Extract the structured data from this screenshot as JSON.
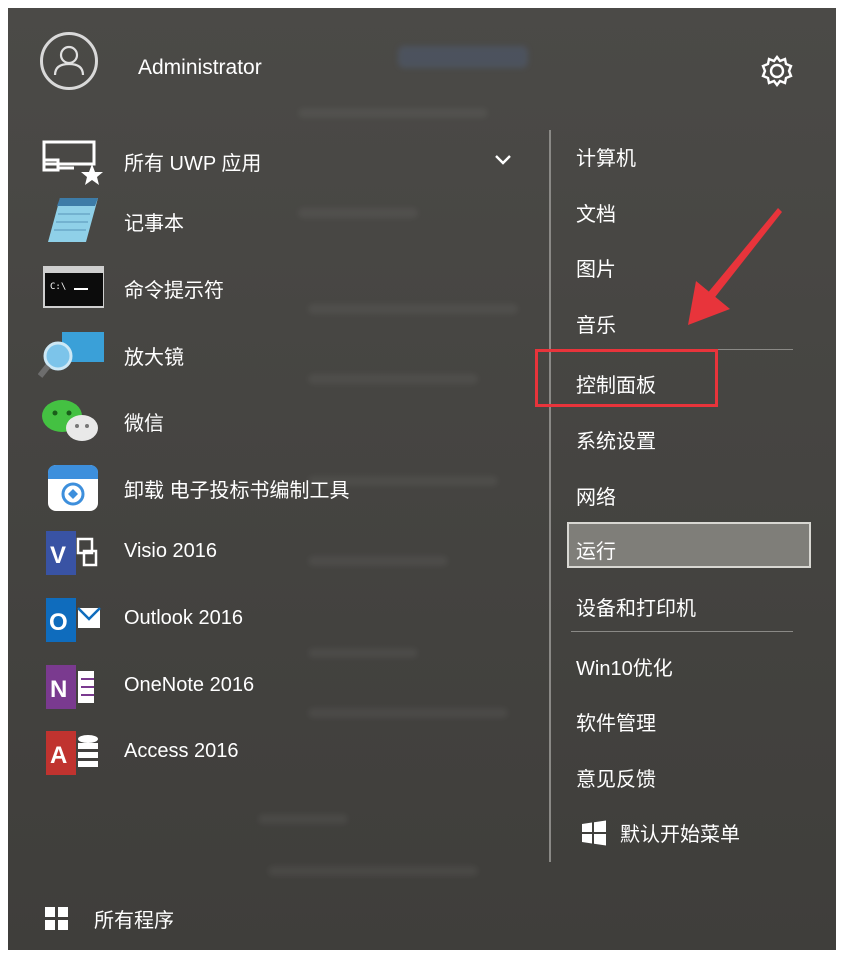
{
  "user": {
    "name": "Administrator"
  },
  "apps": [
    {
      "label": "所有 UWP 应用",
      "icon": "uwp-apps-icon"
    },
    {
      "label": "记事本",
      "icon": "notepad-icon"
    },
    {
      "label": "命令提示符",
      "icon": "cmd-icon"
    },
    {
      "label": "放大镜",
      "icon": "magnifier-icon"
    },
    {
      "label": "微信",
      "icon": "wechat-icon"
    },
    {
      "label": "卸载 电子投标书编制工具",
      "icon": "uninstall-icon"
    },
    {
      "label": "Visio 2016",
      "icon": "visio-icon"
    },
    {
      "label": "Outlook 2016",
      "icon": "outlook-icon"
    },
    {
      "label": "OneNote 2016",
      "icon": "onenote-icon"
    },
    {
      "label": "Access 2016",
      "icon": "access-icon"
    }
  ],
  "right": {
    "computer": "计算机",
    "documents": "文档",
    "pictures": "图片",
    "music": "音乐",
    "control_panel": "控制面板",
    "settings": "系统设置",
    "network": "网络",
    "run": "运行",
    "devices": "设备和打印机",
    "win10_optimize": "Win10优化",
    "software": "软件管理",
    "feedback": "意见反馈",
    "default_menu": "默认开始菜单"
  },
  "footer": {
    "all_programs": "所有程序"
  },
  "colors": {
    "menu_bg": "#45443f",
    "highlight_red": "#e8343b",
    "run_highlight": "#7f7e79",
    "visio": "#3953a4",
    "outlook": "#0f6cbd",
    "onenote": "#7a3a8f",
    "access": "#c0332f"
  }
}
